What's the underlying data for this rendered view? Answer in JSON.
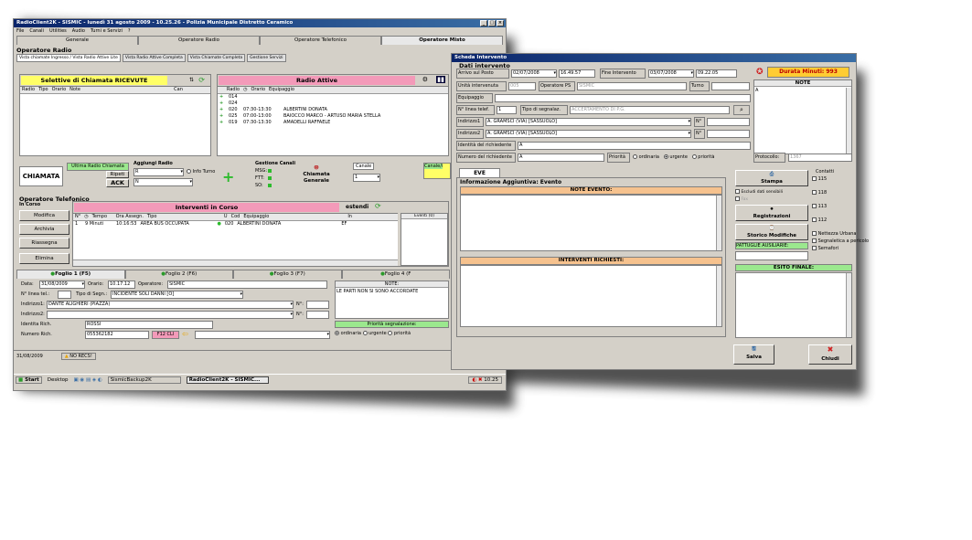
{
  "main_window": {
    "title": "RadioClient2K - SISMIC - lunedì 31 agosto 2009 - 10.25.26 - Polizia Municipale Distretto Ceramico",
    "menu": [
      "File",
      "Canali",
      "Utilities",
      "Audio",
      "Turni e Servizi",
      "?"
    ],
    "tabs": [
      "Generale",
      "Operatore Radio",
      "Operatore Telefonico",
      "Operatore Misto"
    ],
    "section_radio": "Operatore Radio",
    "subtabs": [
      "Vista chiamate Ingresso / Vista Radio Attive Lite",
      "Vista Radio Attive Completa",
      "Vista Chiamate Completa",
      "Gestione Servizi"
    ],
    "selettive": {
      "title": "Selettive di Chiamata RICEVUTE",
      "columns": [
        "Radio",
        "Tipo",
        "Orario",
        "Note",
        "Can"
      ]
    },
    "radio_attive": {
      "title": "Radio Attive",
      "columns": [
        "Radio",
        "Orario",
        "Equipaggio"
      ],
      "rows": [
        {
          "radio": "014",
          "orario": "",
          "equipaggio": ""
        },
        {
          "radio": "024",
          "orario": "",
          "equipaggio": ""
        },
        {
          "radio": "020",
          "orario": "07:30-13:30",
          "equipaggio": "ALBERTINI DONATA"
        },
        {
          "radio": "025",
          "orario": "07:00-13:00",
          "equipaggio": "BAIOCCO MARCO - ARTUSO MARIA STELLA"
        },
        {
          "radio": "019",
          "orario": "07:30-13:30",
          "equipaggio": "AMADELLI RAFFAELE"
        }
      ]
    },
    "chiamata": {
      "label": "CHIAMATA",
      "ultima_label": "Ultima Radio Chiamata",
      "ripeti": "Ripeti",
      "ack": "ACK",
      "aggiungi_label": "Aggiungi Radio",
      "r_label": "R",
      "n_label": "N",
      "info_turno": "Info Turno",
      "gestione_label": "Gestione Canali",
      "msg": "MSG:",
      "ftt": "FTT:",
      "so": "SO:",
      "chiamata_generale": "Chiamata Generale",
      "canale_label": "Canale",
      "canale_value": "1",
      "canale_i": "Canale/i"
    },
    "section_tel": "Operatore Telefonico",
    "in_corso": "In Corso",
    "side_buttons": [
      "Modifica",
      "Archivia",
      "Riassegna",
      "Elimina"
    ],
    "interventi": {
      "title": "Interventi in Corso",
      "estendi": "estendi",
      "eventi": "Eventi (0)",
      "columns": [
        "N°",
        "Tempo",
        "Ora Assegn.",
        "Tipo",
        "U",
        "Cod",
        "Equipaggio",
        "In"
      ],
      "rows": [
        {
          "n": "1",
          "tempo": "9 Minuti",
          "ora": "10:16:53",
          "tipo": "AREA BUS OCCUPATA",
          "cod": "020",
          "equipaggio": "ALBERTINI DONATA",
          "in": "EF"
        }
      ]
    },
    "fogli": [
      "Foglio 1 (F5)",
      "Foglio 2 (F6)",
      "Foglio 3 (F7)",
      "Foglio 4 (F"
    ],
    "form": {
      "data_label": "Data:",
      "data_value": "31/08/2009",
      "orario_label": "Orario:",
      "orario_value": "10.17.12",
      "operatore_label": "Operatore:",
      "operatore_value": "SISMIC",
      "linea_label": "N° linea tel.:",
      "tipo_label": "Tipo di Segn.:",
      "tipo_value": "INCIDENTE SOLI DANNI [O]",
      "ind1_label": "Indirizzo1:",
      "ind1_value": "DANTE ALIGHIERI (PIAZZA)",
      "ind2_label": "Indirizzo2:",
      "n_label": "N°:",
      "identita_label": "Identita Rich.",
      "identita_value": "ROSSI",
      "numero_label": "Numero Rich.",
      "numero_value": "055362182",
      "f12": "F12 CLI",
      "note_label": "NOTE:",
      "note_value": "LE PARTI NON SI SONO ACCORDATE",
      "priorita_label": "Priorità segnalazione:",
      "priorita_options": [
        "ordinaria",
        "urgente",
        "priorità"
      ]
    },
    "status": {
      "date": "31/08/2009",
      "warning": "NO RECS!"
    }
  },
  "taskbar": {
    "start": "Start",
    "desktop": "Desktop",
    "items": [
      "SismicBackup2K",
      "RadioClient2K - SISMIC..."
    ],
    "time": "10.25"
  },
  "scheda": {
    "title": "Scheda Intervento",
    "dati_label": "Dati intervento",
    "arrivo_label": "Arrivo sul Posto",
    "arrivo_date": "02/07/2008",
    "arrivo_time": "16.49.57",
    "fine_label": "Fine Intervento",
    "fine_date": "03/07/2008",
    "fine_time": "09.22.05",
    "durata": "Durata Minuti: 993",
    "note_label": "NOTE",
    "note_value": "A",
    "unita_label": "Unità intervenuta",
    "unita_value": "005",
    "operatore_label": "Operatore PS",
    "operatore_value": "SISMIC",
    "turno_label": "Turno",
    "equipaggio_label": "Equipaggio",
    "linea_label": "N° linea telef.",
    "linea_value": "1",
    "tipo_label": "Tipo di segnalaz.",
    "tipo_value": "ACCERTAMENTO DI P.G.",
    "ind1_label": "Indirizzo1",
    "ind1_value": "A. GRAMSCI (VIA) [SASSUOLO]",
    "ind2_label": "Indirizzo2",
    "ind2_value": "A. GRAMSCI (VIA) [SASSUOLO]",
    "n_label": "N°",
    "identita_label": "Identità del richiedente",
    "identita_value": "A",
    "numero_label": "Numero del richiedente",
    "numero_value": "A",
    "priorita_label": "Priorità",
    "priorita_options": [
      "ordinaria",
      "urgente",
      "priorità"
    ],
    "protocollo_label": "Protocollo:",
    "protocollo_value": "1367",
    "eve_tab": "EVE",
    "info_label": "Informazione Aggiuntiva: Evento",
    "note_evento": "NOTE EVENTO:",
    "interventi_richiesti": "INTERVENTI RICHIESTI:",
    "stampa": "Stampa",
    "escludi": "Escludi dati sensibili",
    "fax": "Fax",
    "registrazioni": "Registrazioni",
    "storico": "Storico Modifiche",
    "pattuglie": "PATTUGLIE AUSILIARIE:",
    "contatti_label": "Contatti",
    "contatti": [
      "115",
      "118",
      "113",
      "112",
      "Nettezza Urbana",
      "Segnaletica a pericolo",
      "Semafori"
    ],
    "esito": "ESITO FINALE:",
    "salva": "Salva",
    "chiudi": "Chiudi"
  },
  "colors": {
    "title_blue": "#0a246a",
    "yellow": "#ffff66",
    "pink": "#f39ab9",
    "green": "#9be88e",
    "orange": "#f6c28e",
    "durata": "#ffcc33"
  }
}
